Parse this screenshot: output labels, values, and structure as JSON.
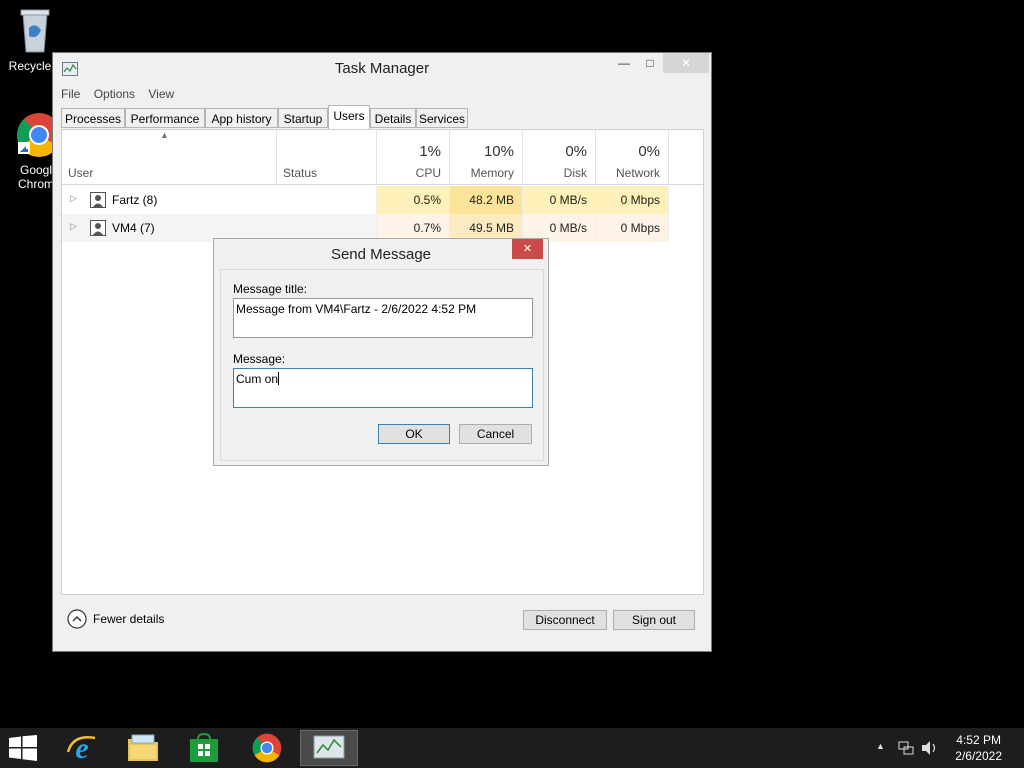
{
  "desktop": {
    "icons": [
      {
        "label": "Recycle",
        "name": "recycle-bin"
      },
      {
        "label": "Googl\nChrom",
        "name": "google-chrome"
      }
    ]
  },
  "task_manager": {
    "title": "Task Manager",
    "window_buttons": {
      "minimize": "—",
      "maximize": "□",
      "close": "✕"
    },
    "menu": [
      "File",
      "Options",
      "View"
    ],
    "tabs": [
      "Processes",
      "Performance",
      "App history",
      "Startup",
      "Users",
      "Details",
      "Services"
    ],
    "active_tab": "Users",
    "columns": {
      "user": "User",
      "status": "Status",
      "cpu": {
        "pct": "1%",
        "name": "CPU"
      },
      "memory": {
        "pct": "10%",
        "name": "Memory"
      },
      "disk": {
        "pct": "0%",
        "name": "Disk"
      },
      "network": {
        "pct": "0%",
        "name": "Network"
      }
    },
    "rows": [
      {
        "user": "Fartz (8)",
        "status": "",
        "cpu": "0.5%",
        "memory": "48.2 MB",
        "disk": "0 MB/s",
        "network": "0 Mbps"
      },
      {
        "user": "VM4 (7)",
        "status": "",
        "cpu": "0.7%",
        "memory": "49.5 MB",
        "disk": "0 MB/s",
        "network": "0 Mbps"
      }
    ],
    "footer": {
      "fewer_details": "Fewer details",
      "disconnect": "Disconnect",
      "sign_out": "Sign out"
    }
  },
  "dialog": {
    "title": "Send Message",
    "close": "✕",
    "message_title_label": "Message title:",
    "message_title_value": "Message from VM4\\Fartz - 2/6/2022 4:52 PM",
    "message_label": "Message:",
    "message_value": "Cum on",
    "ok": "OK",
    "cancel": "Cancel"
  },
  "taskbar": {
    "apps": [
      "start",
      "internet-explorer",
      "file-explorer",
      "store",
      "chrome",
      "task-manager"
    ],
    "time": "4:52 PM",
    "date": "2/6/2022"
  },
  "colors": {
    "cpu_heat": "#fdf0b8",
    "mem_heat": "#fbe39a",
    "accent": "#3c7fb1",
    "close_red": "#c84a4a"
  }
}
